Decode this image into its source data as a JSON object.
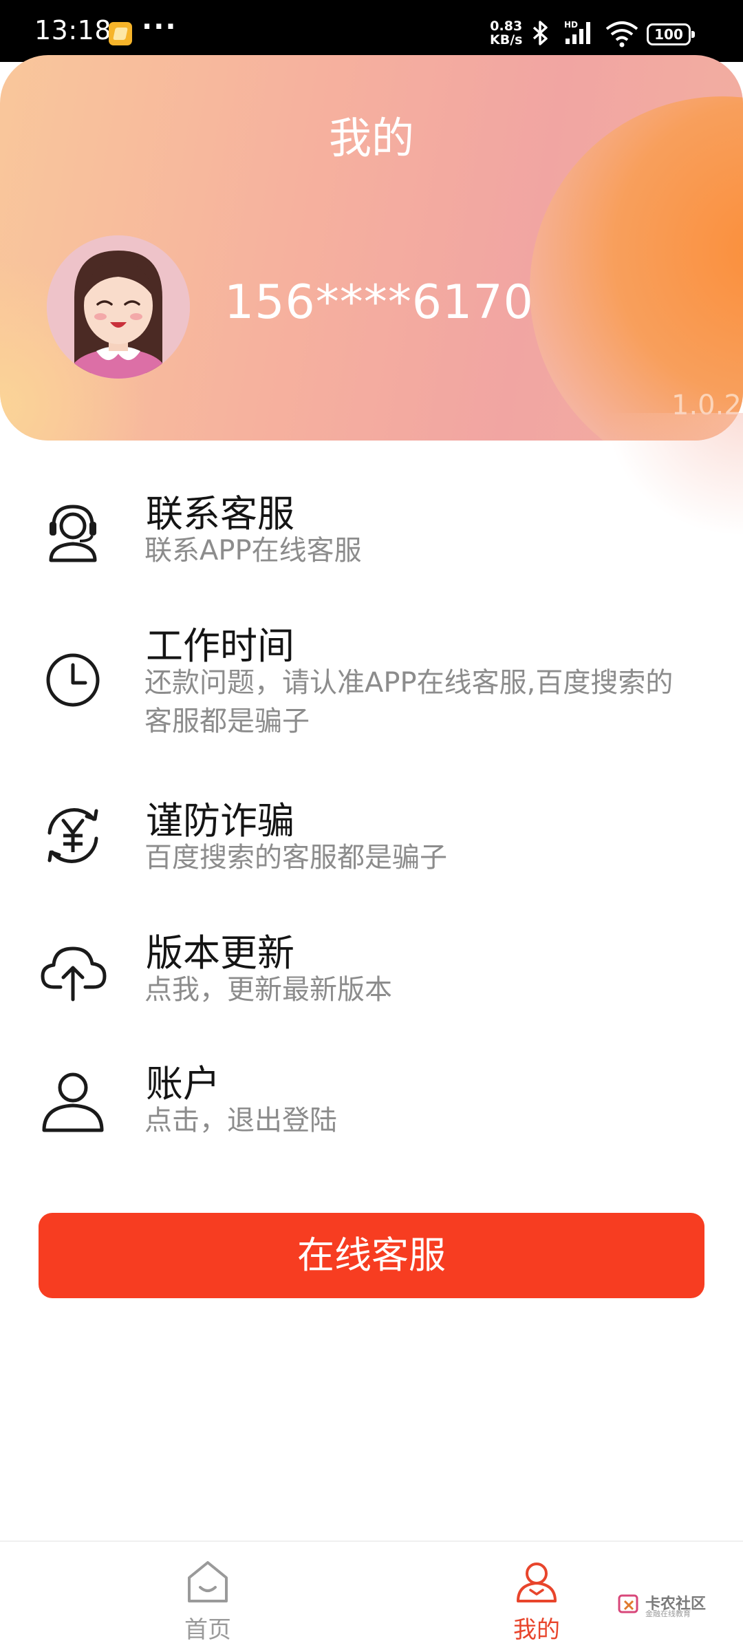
{
  "status_bar": {
    "time": "13:18",
    "more": "···",
    "net_speed_value": "0.83",
    "net_speed_unit": "KB/s",
    "signal_label": "HD",
    "battery": "100"
  },
  "header": {
    "title": "我的",
    "phone": "156****6170",
    "version": "1.0.2"
  },
  "menu": [
    {
      "title": "联系客服",
      "subtitle": "联系APP在线客服",
      "icon": "headset-icon"
    },
    {
      "title": "工作时间",
      "subtitle": "还款问题，请认准APP在线客服,百度搜索的客服都是骗子",
      "icon": "clock-icon"
    },
    {
      "title": "谨防诈骗",
      "subtitle": "百度搜索的客服都是骗子",
      "icon": "yen-exchange-icon"
    },
    {
      "title": "版本更新",
      "subtitle": "点我，更新最新版本",
      "icon": "cloud-upload-icon"
    },
    {
      "title": "账户",
      "subtitle": "点击，退出登陆",
      "icon": "user-icon"
    }
  ],
  "cta": {
    "label": "在线客服"
  },
  "bottom_nav": {
    "items": [
      {
        "label": "首页",
        "icon": "home-icon",
        "active": false
      },
      {
        "label": "我的",
        "icon": "profile-icon",
        "active": true
      }
    ]
  },
  "watermark": {
    "text": "卡农社区",
    "sub": "金融在线教育"
  },
  "colors": {
    "accent": "#f73d21",
    "active_nav": "#e8452c",
    "inactive_nav": "#9a9a9a",
    "title_text": "#141414",
    "sub_text": "#8c8c8c"
  }
}
